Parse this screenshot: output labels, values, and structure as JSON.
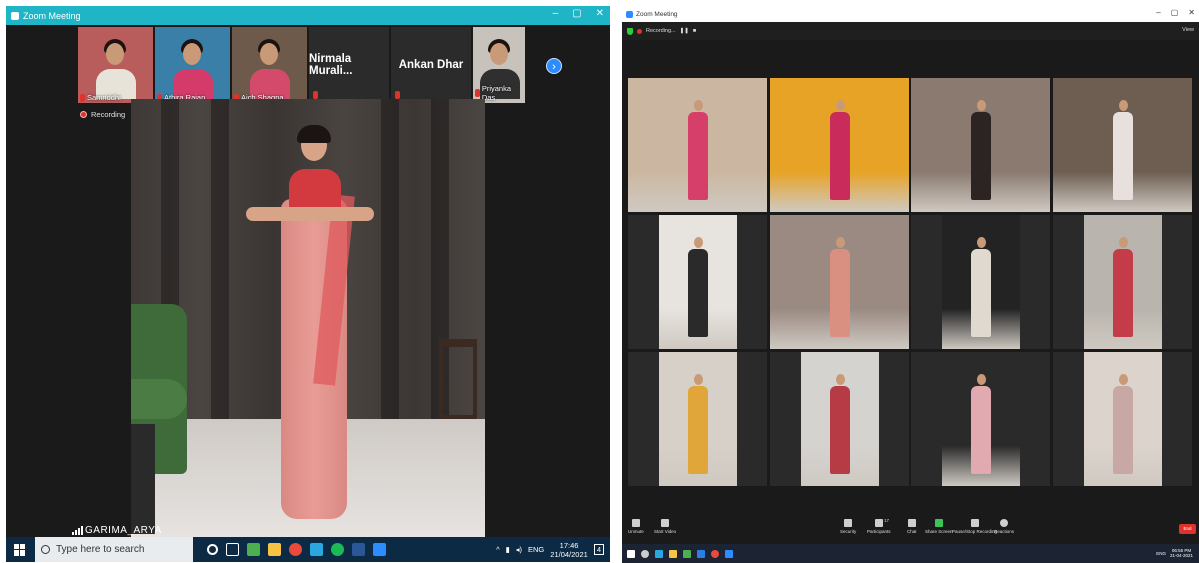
{
  "left": {
    "title": "Zoom Meeting",
    "window_controls": [
      "–",
      "▢",
      "✕"
    ],
    "thumbnails": [
      {
        "name": "Samriddhi",
        "kind": "video",
        "bg": "#b85c5c",
        "shirt": "#e8e3d8"
      },
      {
        "name": "Athira Rajan",
        "kind": "video",
        "bg": "#3a7fa8",
        "shirt": "#d43b6a"
      },
      {
        "name": "Aich Shagna",
        "kind": "video",
        "bg": "#6e5a4a",
        "shirt": "#d44a6b"
      },
      {
        "name": "Nirmala  Murali...",
        "kind": "name"
      },
      {
        "name": "Ankan Dhar",
        "kind": "name"
      },
      {
        "name": "Priyanka Das",
        "kind": "video",
        "bg": "#c7c2bc",
        "shirt": "#2f2f2f"
      }
    ],
    "next_icon": "›",
    "recording_label": "Recording",
    "speaker_name": "GARIMA_ARYA",
    "taskbar": {
      "search_placeholder": "Type here to search",
      "tray_text": "ENG",
      "time": "17:46",
      "date": "21/04/2021",
      "notification_count": "4"
    }
  },
  "right": {
    "title": "Zoom Meeting",
    "window_controls": [
      "–",
      "▢",
      "✕"
    ],
    "recording_label": "Recording...",
    "view_label": "View",
    "toolbar": {
      "unmute": "Unmute",
      "start_video": "Start Video",
      "security": "Security",
      "participants": "Participants",
      "participants_count": "17",
      "chat": "Chat",
      "share_screen": "Share Screen",
      "pause_recording": "Pause/Stop Recording",
      "reactions": "Reactions",
      "end": "End"
    },
    "taskbar": {
      "time": "06:55 PM",
      "date": "21-04-2021",
      "tray_text": "ENG"
    }
  },
  "colors": {
    "zoom_blue": "#2d8cff",
    "titlebar_teal": "#1fb5c6",
    "recording_red": "#e0322c",
    "active_speaker": "#c8e63a",
    "share_green": "#3bc45a"
  }
}
